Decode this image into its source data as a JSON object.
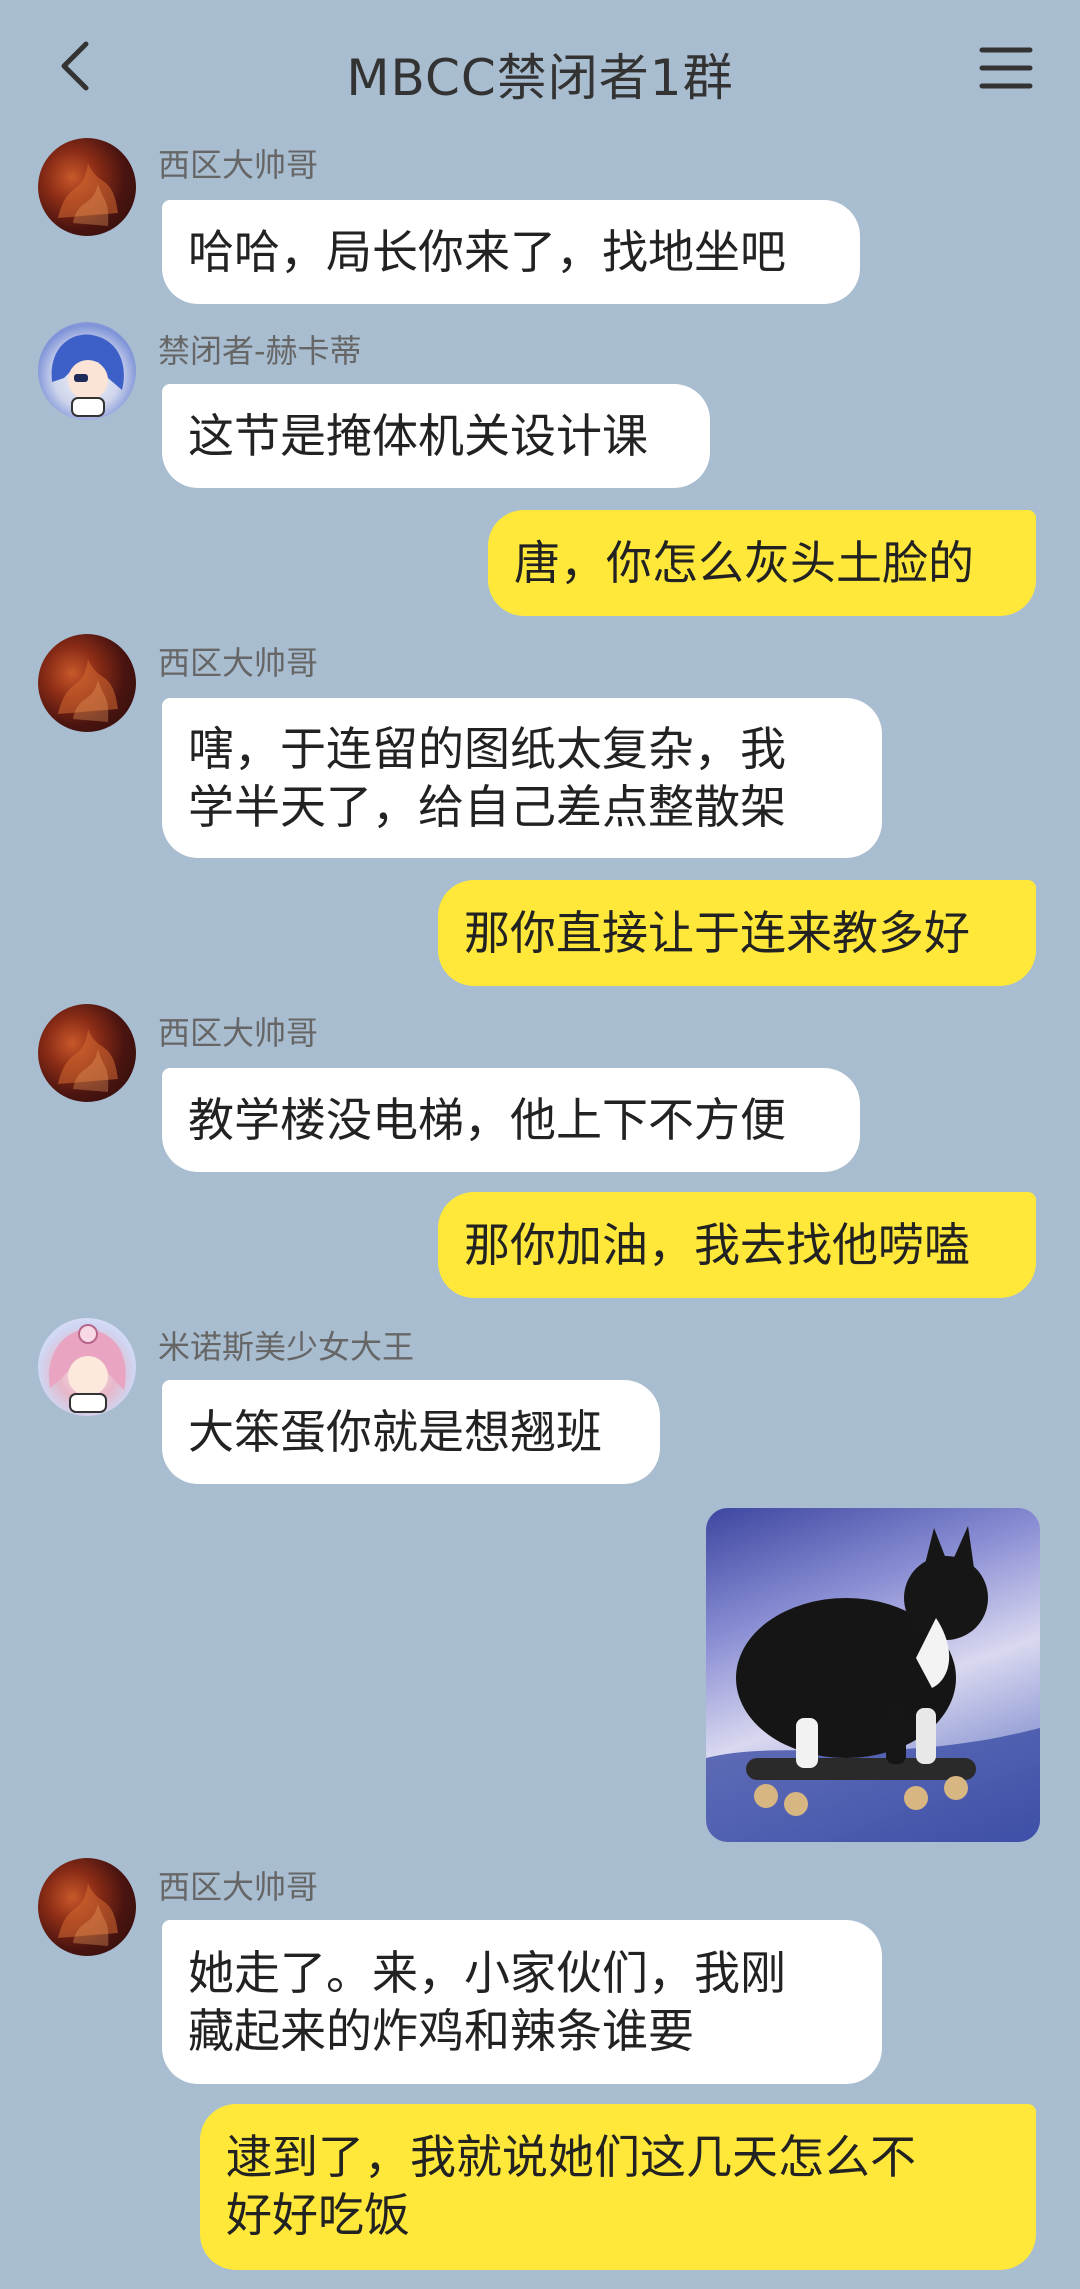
{
  "header": {
    "title": "MBCC禁闭者1群",
    "back_icon": "chevron-left-icon",
    "menu_icon": "hamburger-menu-icon"
  },
  "colors": {
    "background": "#a9bdd0",
    "bubble_incoming": "#ffffff",
    "bubble_outgoing": "#ffe83a"
  },
  "messages": [
    {
      "direction": "in",
      "sender": "西区大帅哥",
      "avatar": "red-flame-avatar",
      "text": "哈哈，局长你来了，找地坐吧"
    },
    {
      "direction": "in",
      "sender": "禁闭者-赫卡蒂",
      "avatar": "blue-hair-chibi-avatar",
      "text": "这节是掩体机关设计课"
    },
    {
      "direction": "out",
      "text": "唐，你怎么灰头土脸的"
    },
    {
      "direction": "in",
      "sender": "西区大帅哥",
      "avatar": "red-flame-avatar",
      "text": "嗐，于连留的图纸太复杂，我\n学半天了，给自己差点整散架"
    },
    {
      "direction": "out",
      "text": "那你直接让于连来教多好"
    },
    {
      "direction": "in",
      "sender": "西区大帅哥",
      "avatar": "red-flame-avatar",
      "text": "教学楼没电梯，他上下不方便"
    },
    {
      "direction": "out",
      "text": "那你加油，我去找他唠嗑"
    },
    {
      "direction": "in",
      "sender": "米诺斯美少女大王",
      "avatar": "pink-hair-chibi-avatar",
      "text": "大笨蛋你就是想翘班"
    },
    {
      "direction": "out",
      "type": "image",
      "image": "cat-on-skateboard-image"
    },
    {
      "direction": "in",
      "sender": "西区大帅哥",
      "avatar": "red-flame-avatar",
      "text": "她走了。来，小家伙们，我刚\n藏起来的炸鸡和辣条谁要"
    },
    {
      "direction": "out",
      "text": "逮到了，我就说她们这几天怎么不\n好好吃饭"
    }
  ]
}
